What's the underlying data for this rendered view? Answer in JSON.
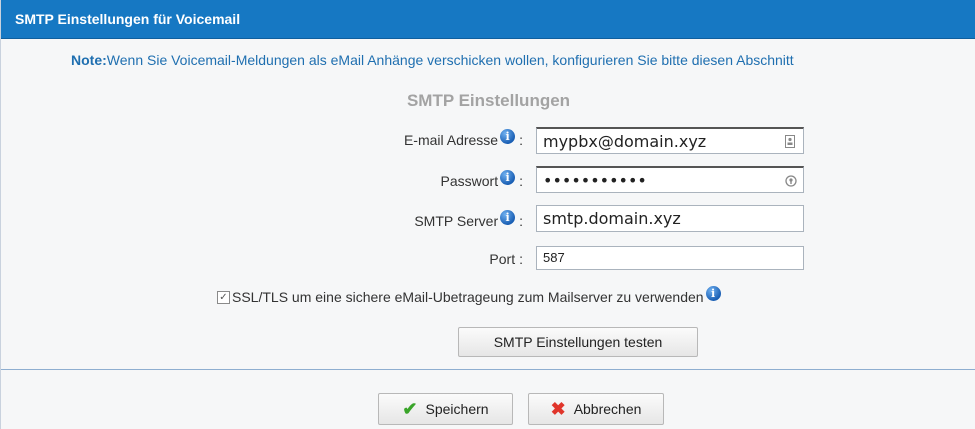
{
  "window": {
    "title": "SMTP Einstellungen für Voicemail"
  },
  "note": {
    "prefix": "Note:",
    "text": "Wenn Sie Voicemail-Meldungen als eMail Anhänge verschicken wollen, konfigurieren Sie bitte diesen Abschnitt"
  },
  "section": {
    "title": "SMTP Einstellungen"
  },
  "fields": {
    "email": {
      "label": "E-mail Adresse",
      "value": "mypbx@domain.xyz",
      "icon": "contact-card-icon"
    },
    "password": {
      "label": "Passwort",
      "value": "•••••••••••",
      "icon": "key-icon"
    },
    "server": {
      "label": "SMTP Server",
      "value": "smtp.domain.xyz"
    },
    "port": {
      "label": "Port",
      "value": "587"
    }
  },
  "ssl": {
    "checked": true,
    "label": "SSL/TLS um eine sichere eMail-Ubetrageung zum Mailserver zu verwenden"
  },
  "buttons": {
    "test": "SMTP Einstellungen testen",
    "save": "Speichern",
    "cancel": "Abbrechen"
  },
  "colors": {
    "titlebar": "#1678c3",
    "note": "#1f6fb0",
    "section_title": "#a3a3a3"
  }
}
